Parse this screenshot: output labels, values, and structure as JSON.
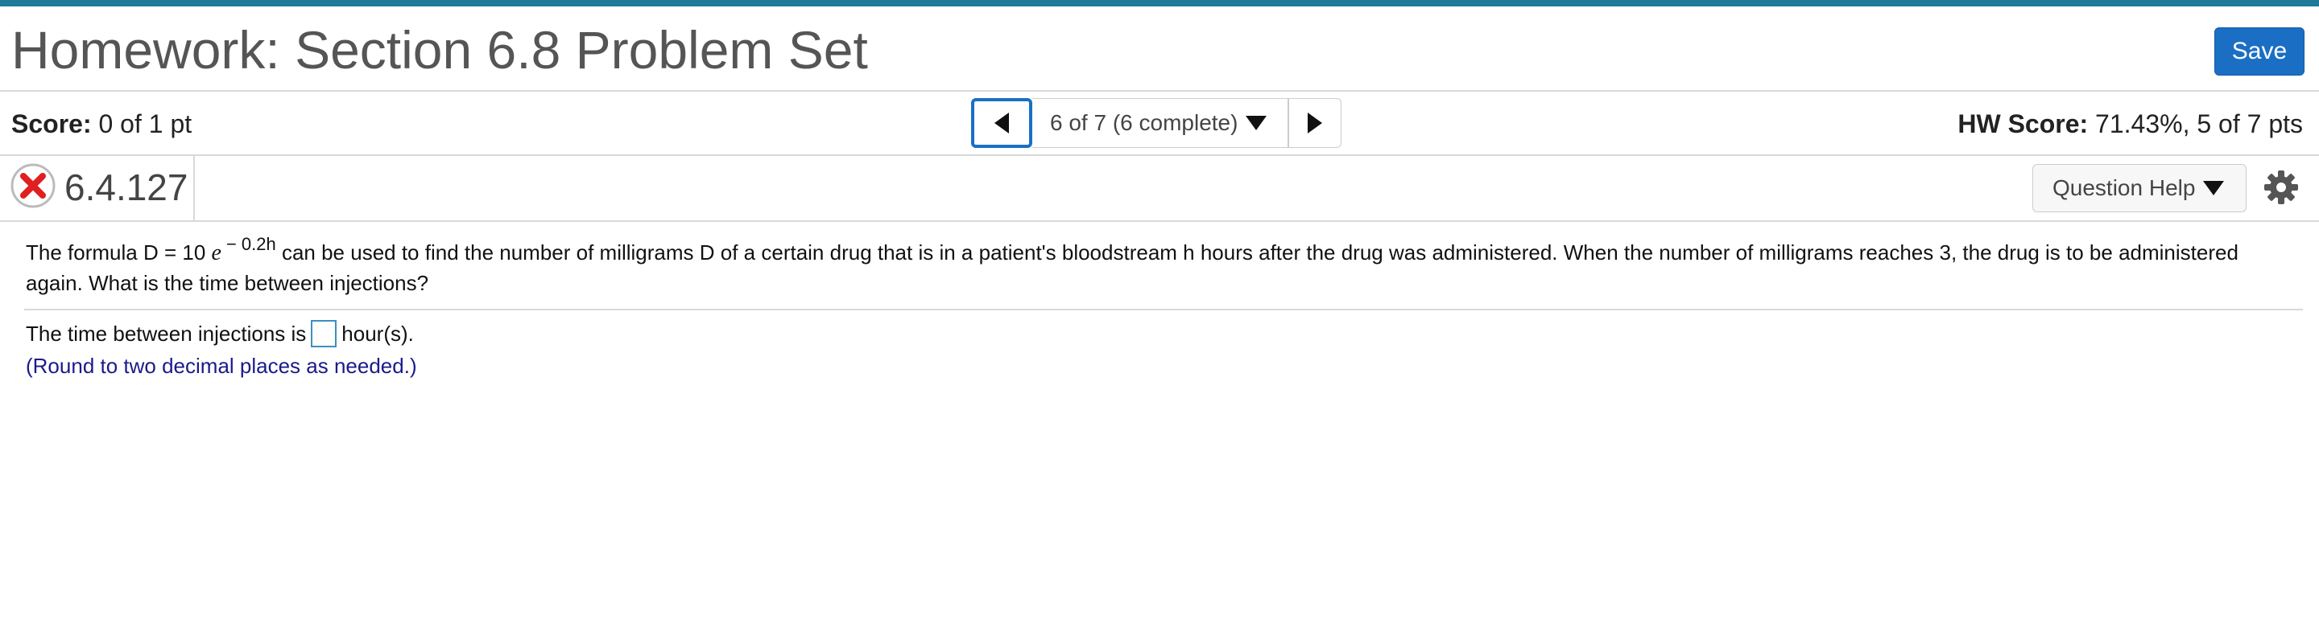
{
  "header": {
    "title": "Homework: Section 6.8 Problem Set",
    "save_label": "Save",
    "accent_color": "#1e7a96",
    "save_color": "#1a6fc4"
  },
  "score_bar": {
    "score_label": "Score:",
    "score_value": "0 of 1 pt",
    "nav_progress": "6 of 7 (6 complete)",
    "hw_score_label": "HW Score:",
    "hw_score_value": "71.43%, 5 of 7 pts",
    "prev_icon": "triangle-left-icon",
    "next_icon": "triangle-right-icon"
  },
  "question": {
    "status_icon": "incorrect-x-icon",
    "status_color": "#e02020",
    "number": "6.4.127",
    "help_label": "Question Help",
    "settings_icon": "gear-icon",
    "text_prefix": "The formula D = 10 ",
    "formula_e": "e",
    "formula_exponent": "− 0.2h",
    "text_suffix": " can be used to find the number of milligrams D of a certain drug that is in a patient's bloodstream h hours after the drug was administered. When the number of milligrams reaches 3, the drug is to be administered again. What is the time between injections?",
    "answer_prefix": "The time between injections is",
    "answer_value": "",
    "answer_suffix": "hour(s).",
    "round_note": "(Round to two decimal places as needed.)"
  }
}
